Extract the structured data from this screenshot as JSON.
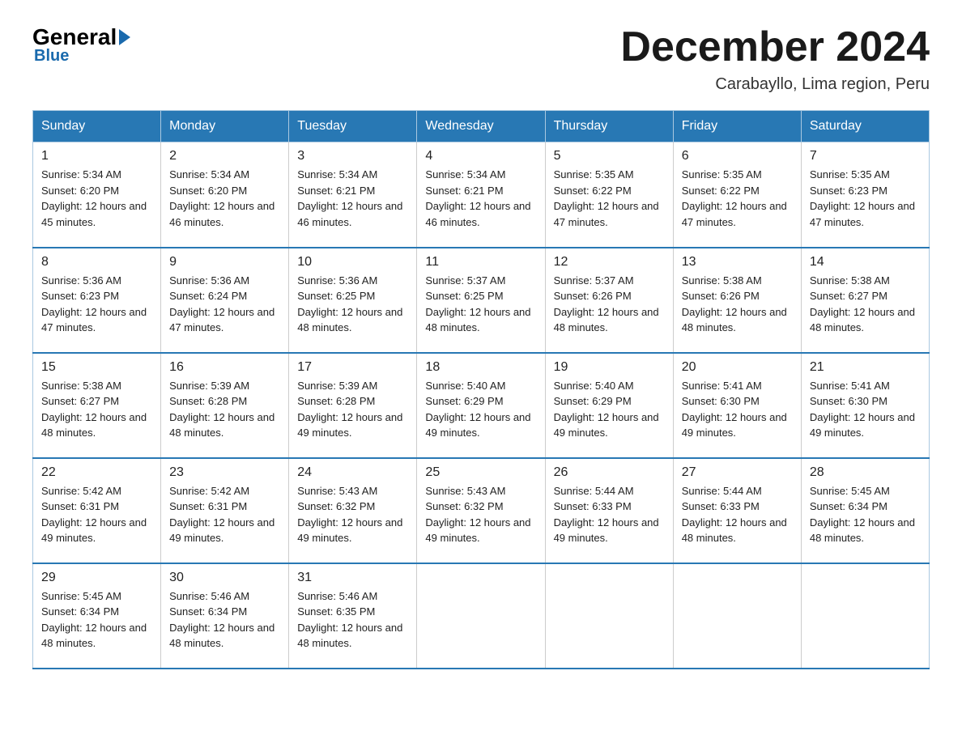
{
  "header": {
    "logo_general": "General",
    "logo_blue": "Blue",
    "month_title": "December 2024",
    "location": "Carabayllo, Lima region, Peru"
  },
  "days_of_week": [
    "Sunday",
    "Monday",
    "Tuesday",
    "Wednesday",
    "Thursday",
    "Friday",
    "Saturday"
  ],
  "weeks": [
    [
      {
        "day": "1",
        "sunrise": "5:34 AM",
        "sunset": "6:20 PM",
        "daylight": "12 hours and 45 minutes."
      },
      {
        "day": "2",
        "sunrise": "5:34 AM",
        "sunset": "6:20 PM",
        "daylight": "12 hours and 46 minutes."
      },
      {
        "day": "3",
        "sunrise": "5:34 AM",
        "sunset": "6:21 PM",
        "daylight": "12 hours and 46 minutes."
      },
      {
        "day": "4",
        "sunrise": "5:34 AM",
        "sunset": "6:21 PM",
        "daylight": "12 hours and 46 minutes."
      },
      {
        "day": "5",
        "sunrise": "5:35 AM",
        "sunset": "6:22 PM",
        "daylight": "12 hours and 47 minutes."
      },
      {
        "day": "6",
        "sunrise": "5:35 AM",
        "sunset": "6:22 PM",
        "daylight": "12 hours and 47 minutes."
      },
      {
        "day": "7",
        "sunrise": "5:35 AM",
        "sunset": "6:23 PM",
        "daylight": "12 hours and 47 minutes."
      }
    ],
    [
      {
        "day": "8",
        "sunrise": "5:36 AM",
        "sunset": "6:23 PM",
        "daylight": "12 hours and 47 minutes."
      },
      {
        "day": "9",
        "sunrise": "5:36 AM",
        "sunset": "6:24 PM",
        "daylight": "12 hours and 47 minutes."
      },
      {
        "day": "10",
        "sunrise": "5:36 AM",
        "sunset": "6:25 PM",
        "daylight": "12 hours and 48 minutes."
      },
      {
        "day": "11",
        "sunrise": "5:37 AM",
        "sunset": "6:25 PM",
        "daylight": "12 hours and 48 minutes."
      },
      {
        "day": "12",
        "sunrise": "5:37 AM",
        "sunset": "6:26 PM",
        "daylight": "12 hours and 48 minutes."
      },
      {
        "day": "13",
        "sunrise": "5:38 AM",
        "sunset": "6:26 PM",
        "daylight": "12 hours and 48 minutes."
      },
      {
        "day": "14",
        "sunrise": "5:38 AM",
        "sunset": "6:27 PM",
        "daylight": "12 hours and 48 minutes."
      }
    ],
    [
      {
        "day": "15",
        "sunrise": "5:38 AM",
        "sunset": "6:27 PM",
        "daylight": "12 hours and 48 minutes."
      },
      {
        "day": "16",
        "sunrise": "5:39 AM",
        "sunset": "6:28 PM",
        "daylight": "12 hours and 48 minutes."
      },
      {
        "day": "17",
        "sunrise": "5:39 AM",
        "sunset": "6:28 PM",
        "daylight": "12 hours and 49 minutes."
      },
      {
        "day": "18",
        "sunrise": "5:40 AM",
        "sunset": "6:29 PM",
        "daylight": "12 hours and 49 minutes."
      },
      {
        "day": "19",
        "sunrise": "5:40 AM",
        "sunset": "6:29 PM",
        "daylight": "12 hours and 49 minutes."
      },
      {
        "day": "20",
        "sunrise": "5:41 AM",
        "sunset": "6:30 PM",
        "daylight": "12 hours and 49 minutes."
      },
      {
        "day": "21",
        "sunrise": "5:41 AM",
        "sunset": "6:30 PM",
        "daylight": "12 hours and 49 minutes."
      }
    ],
    [
      {
        "day": "22",
        "sunrise": "5:42 AM",
        "sunset": "6:31 PM",
        "daylight": "12 hours and 49 minutes."
      },
      {
        "day": "23",
        "sunrise": "5:42 AM",
        "sunset": "6:31 PM",
        "daylight": "12 hours and 49 minutes."
      },
      {
        "day": "24",
        "sunrise": "5:43 AM",
        "sunset": "6:32 PM",
        "daylight": "12 hours and 49 minutes."
      },
      {
        "day": "25",
        "sunrise": "5:43 AM",
        "sunset": "6:32 PM",
        "daylight": "12 hours and 49 minutes."
      },
      {
        "day": "26",
        "sunrise": "5:44 AM",
        "sunset": "6:33 PM",
        "daylight": "12 hours and 49 minutes."
      },
      {
        "day": "27",
        "sunrise": "5:44 AM",
        "sunset": "6:33 PM",
        "daylight": "12 hours and 48 minutes."
      },
      {
        "day": "28",
        "sunrise": "5:45 AM",
        "sunset": "6:34 PM",
        "daylight": "12 hours and 48 minutes."
      }
    ],
    [
      {
        "day": "29",
        "sunrise": "5:45 AM",
        "sunset": "6:34 PM",
        "daylight": "12 hours and 48 minutes."
      },
      {
        "day": "30",
        "sunrise": "5:46 AM",
        "sunset": "6:34 PM",
        "daylight": "12 hours and 48 minutes."
      },
      {
        "day": "31",
        "sunrise": "5:46 AM",
        "sunset": "6:35 PM",
        "daylight": "12 hours and 48 minutes."
      },
      {
        "day": "",
        "sunrise": "",
        "sunset": "",
        "daylight": ""
      },
      {
        "day": "",
        "sunrise": "",
        "sunset": "",
        "daylight": ""
      },
      {
        "day": "",
        "sunrise": "",
        "sunset": "",
        "daylight": ""
      },
      {
        "day": "",
        "sunrise": "",
        "sunset": "",
        "daylight": ""
      }
    ]
  ],
  "labels": {
    "sunrise": "Sunrise: ",
    "sunset": "Sunset: ",
    "daylight": "Daylight: "
  }
}
